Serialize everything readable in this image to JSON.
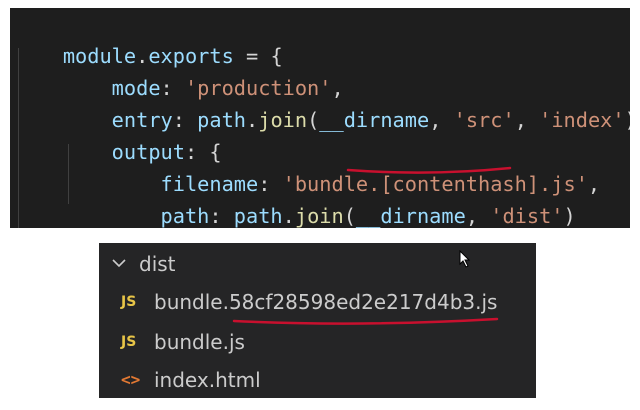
{
  "editor": {
    "lines": [
      {
        "tokens": [
          {
            "t": "module",
            "c": "var"
          },
          {
            "t": ".",
            "c": "pun"
          },
          {
            "t": "exports",
            "c": "var"
          },
          {
            "t": " = {",
            "c": "pun"
          }
        ]
      },
      {
        "tokens": [
          {
            "t": "    mode",
            "c": "var"
          },
          {
            "t": ": ",
            "c": "pun"
          },
          {
            "t": "'production'",
            "c": "str"
          },
          {
            "t": ",",
            "c": "pun"
          }
        ]
      },
      {
        "tokens": [
          {
            "t": "    entry",
            "c": "var"
          },
          {
            "t": ": ",
            "c": "pun"
          },
          {
            "t": "path",
            "c": "var"
          },
          {
            "t": ".",
            "c": "pun"
          },
          {
            "t": "join",
            "c": "fn"
          },
          {
            "t": "(",
            "c": "pun"
          },
          {
            "t": "__dirname",
            "c": "var"
          },
          {
            "t": ", ",
            "c": "pun"
          },
          {
            "t": "'src'",
            "c": "str"
          },
          {
            "t": ", ",
            "c": "pun"
          },
          {
            "t": "'index'",
            "c": "str"
          },
          {
            "t": "),",
            "c": "pun"
          }
        ]
      },
      {
        "tokens": [
          {
            "t": "    output",
            "c": "var"
          },
          {
            "t": ": {",
            "c": "pun"
          }
        ]
      },
      {
        "tokens": [
          {
            "t": "        filename",
            "c": "var"
          },
          {
            "t": ": ",
            "c": "pun"
          },
          {
            "t": "'bundle.[contenthash].js'",
            "c": "str"
          },
          {
            "t": ",",
            "c": "pun"
          }
        ]
      },
      {
        "tokens": [
          {
            "t": "        path",
            "c": "var"
          },
          {
            "t": ": ",
            "c": "pun"
          },
          {
            "t": "path",
            "c": "var"
          },
          {
            "t": ".",
            "c": "pun"
          },
          {
            "t": "join",
            "c": "fn"
          },
          {
            "t": "(",
            "c": "pun"
          },
          {
            "t": "__dirname",
            "c": "var"
          },
          {
            "t": ", ",
            "c": "pun"
          },
          {
            "t": "'dist'",
            "c": "str"
          },
          {
            "t": ")",
            "c": "pun"
          }
        ]
      },
      {
        "tokens": [
          {
            "t": "    },",
            "c": "pun"
          }
        ]
      }
    ]
  },
  "explorer": {
    "folder": {
      "label": "dist",
      "icon": "chevron-down-icon"
    },
    "files": [
      {
        "name": "bundle.58cf28598ed2e217d4b3.js",
        "icon_text": "JS",
        "icon": "js-file-icon"
      },
      {
        "name": "bundle.js",
        "icon_text": "JS",
        "icon": "js-file-icon"
      },
      {
        "name": "index.html",
        "icon_text": "<>",
        "icon": "html-file-icon"
      }
    ]
  },
  "colors": {
    "editor_bg": "#1e1e1e",
    "explorer_bg": "#252526",
    "string": "#ce9178",
    "variable": "#9cdcfe",
    "function": "#dcdcaa",
    "js_icon": "#e8c547",
    "html_icon": "#e37933",
    "annotation": "#c8102e"
  }
}
